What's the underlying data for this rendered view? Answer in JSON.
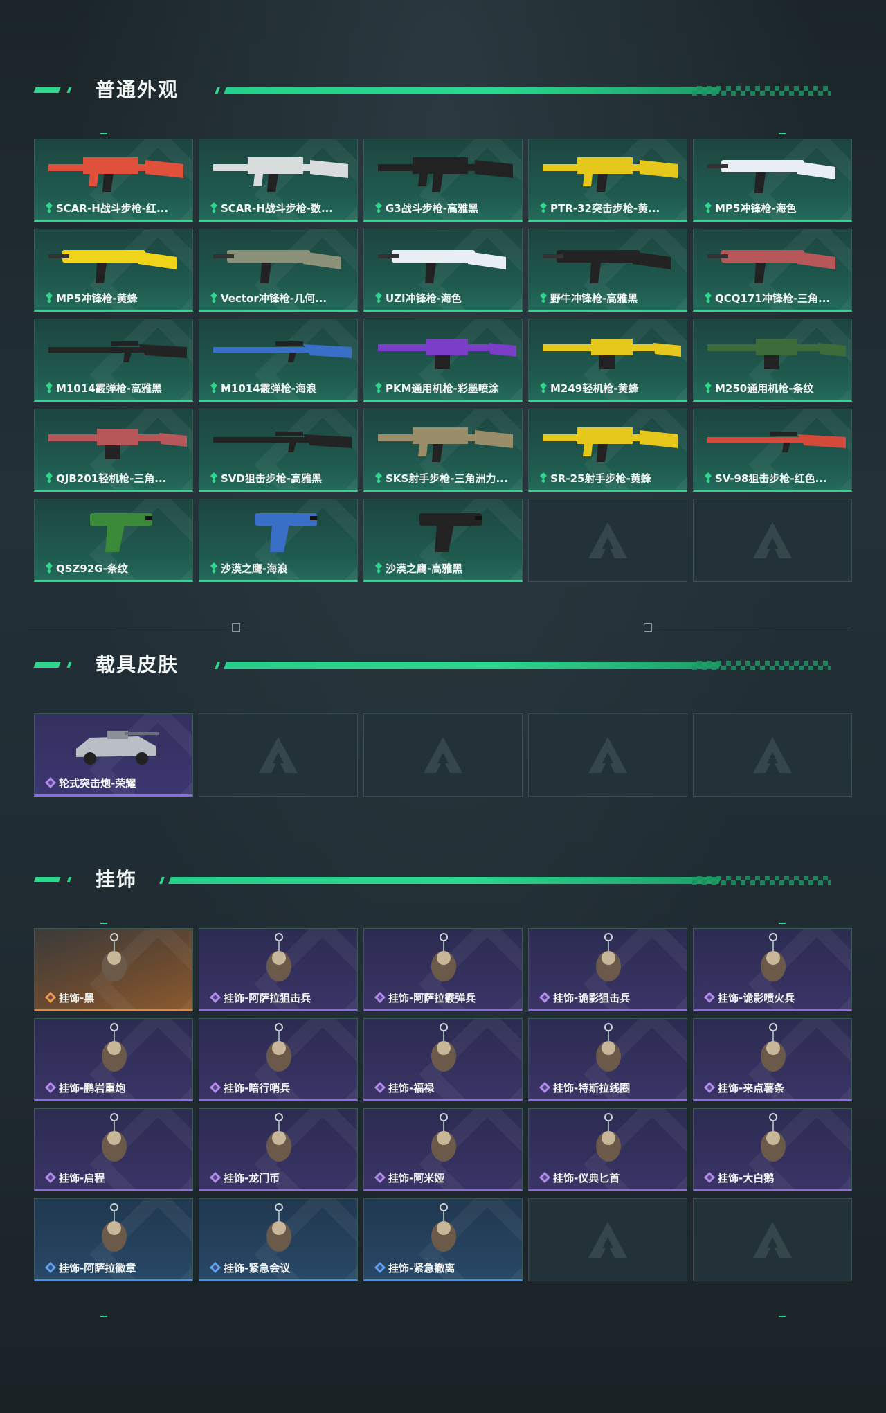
{
  "sections": {
    "weapons": {
      "title": "普通外观",
      "items": [
        {
          "label": "SCAR-H战斗步枪-红...",
          "icon": "rifle-red-icon",
          "color": "#e0503a"
        },
        {
          "label": "SCAR-H战斗步枪-数...",
          "icon": "rifle-white-icon",
          "color": "#d9dcdc"
        },
        {
          "label": "G3战斗步枪-高雅黑",
          "icon": "rifle-black-icon",
          "color": "#222222"
        },
        {
          "label": "PTR-32突击步枪-黄...",
          "icon": "rifle-yellow-icon",
          "color": "#e6c81c"
        },
        {
          "label": "MP5冲锋枪-海色",
          "icon": "smg-white-blue-icon",
          "color": "#e9eef4"
        },
        {
          "label": "MP5冲锋枪-黄蜂",
          "icon": "smg-yellow-icon",
          "color": "#f0d41a"
        },
        {
          "label": "Vector冲锋枪-几何...",
          "icon": "smg-camo-icon",
          "color": "#8c927a"
        },
        {
          "label": "UZI冲锋枪-海色",
          "icon": "smg-white-blue-icon",
          "color": "#e9eef4"
        },
        {
          "label": "野牛冲锋枪-高雅黑",
          "icon": "smg-black-icon",
          "color": "#232323"
        },
        {
          "label": "QCQ171冲锋枪-三角...",
          "icon": "smg-red-camo-icon",
          "color": "#b8575a"
        },
        {
          "label": "M1014霰弹枪-高雅黑",
          "icon": "shotgun-black-icon",
          "color": "#232323"
        },
        {
          "label": "M1014霰弹枪-海浪",
          "icon": "shotgun-blue-icon",
          "color": "#3a6fc8"
        },
        {
          "label": "PKM通用机枪-彩墨喷涂",
          "icon": "mg-purple-icon",
          "color": "#7a3ec8"
        },
        {
          "label": "M249轻机枪-黄蜂",
          "icon": "mg-yellow-icon",
          "color": "#e6c81c"
        },
        {
          "label": "M250通用机枪-条纹",
          "icon": "mg-green-icon",
          "color": "#3d6b3a"
        },
        {
          "label": "QJB201轻机枪-三角...",
          "icon": "mg-red-camo-icon",
          "color": "#b8575a"
        },
        {
          "label": "SVD狙击步枪-高雅黑",
          "icon": "sniper-black-icon",
          "color": "#232323"
        },
        {
          "label": "SKS射手步枪-三角洲力...",
          "icon": "rifle-desert-icon",
          "color": "#9a8d6a"
        },
        {
          "label": "SR-25射手步枪-黄蜂",
          "icon": "rifle-yellow-icon",
          "color": "#e6c81c"
        },
        {
          "label": "SV-98狙击步枪-红色...",
          "icon": "sniper-red-icon",
          "color": "#d44a3a"
        },
        {
          "label": "QSZ92G-条纹",
          "icon": "pistol-green-icon",
          "color": "#3a8a3a"
        },
        {
          "label": "沙漠之鹰-海浪",
          "icon": "pistol-blue-icon",
          "color": "#3a6fc8"
        },
        {
          "label": "沙漠之鹰-高雅黑",
          "icon": "pistol-black-icon",
          "color": "#232323"
        }
      ],
      "empty_slots": 2
    },
    "vehicles": {
      "title": "载具皮肤",
      "items": [
        {
          "label": "轮式突击炮-荣耀",
          "icon": "armored-vehicle-icon",
          "color": "#c0c4c8"
        }
      ],
      "empty_slots": 4
    },
    "charms": {
      "title": "挂饰",
      "items": [
        {
          "label": "挂饰-黑",
          "rarity": "orange",
          "icon": "charm-tag-icon"
        },
        {
          "label": "挂饰-阿萨拉狙击兵",
          "rarity": "purple",
          "icon": "charm-figure-icon"
        },
        {
          "label": "挂饰-阿萨拉霰弹兵",
          "rarity": "purple",
          "icon": "charm-figure-icon"
        },
        {
          "label": "挂饰-诡影狙击兵",
          "rarity": "purple",
          "icon": "charm-figure-icon"
        },
        {
          "label": "挂饰-诡影喷火兵",
          "rarity": "purple",
          "icon": "charm-figure-icon"
        },
        {
          "label": "挂饰-鹏岩重炮",
          "rarity": "purple",
          "icon": "charm-figure-icon"
        },
        {
          "label": "挂饰-暗行哨兵",
          "rarity": "purple",
          "icon": "charm-figure-icon"
        },
        {
          "label": "挂饰-福禄",
          "rarity": "purple",
          "icon": "charm-gourd-icon"
        },
        {
          "label": "挂饰-特斯拉线圈",
          "rarity": "purple",
          "icon": "charm-coil-icon"
        },
        {
          "label": "挂饰-来点薯条",
          "rarity": "purple",
          "icon": "charm-fries-icon"
        },
        {
          "label": "挂饰-启程",
          "rarity": "purple",
          "icon": "charm-ring-icon"
        },
        {
          "label": "挂饰-龙门币",
          "rarity": "purple",
          "icon": "charm-card-icon"
        },
        {
          "label": "挂饰-阿米娅",
          "rarity": "purple",
          "icon": "charm-bunny-icon"
        },
        {
          "label": "挂饰-仪典匕首",
          "rarity": "purple",
          "icon": "charm-dagger-icon"
        },
        {
          "label": "挂饰-大白鹅",
          "rarity": "purple",
          "icon": "charm-goose-icon"
        },
        {
          "label": "挂饰-阿萨拉徽章",
          "rarity": "blue",
          "icon": "charm-badge-icon"
        },
        {
          "label": "挂饰-紧急会议",
          "rarity": "blue",
          "icon": "charm-figure-icon"
        },
        {
          "label": "挂饰-紧急撤离",
          "rarity": "blue",
          "icon": "charm-box-icon"
        }
      ],
      "empty_slots": 2
    }
  },
  "colors": {
    "accent_green": "#2fd78c",
    "rarity_purple": "#8d6adf",
    "rarity_orange": "#e08a3c",
    "rarity_blue": "#4b8ee6"
  }
}
